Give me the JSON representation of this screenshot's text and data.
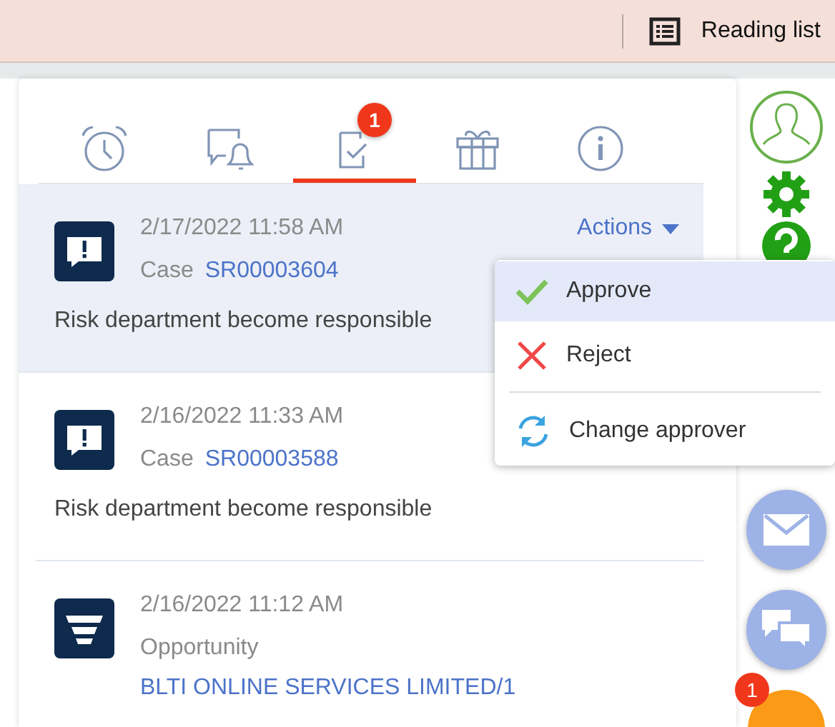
{
  "browser_toolbar": {
    "reading_list": "Reading list"
  },
  "tabs": [
    {
      "kind": "reminders",
      "selected": false
    },
    {
      "kind": "notifications",
      "selected": false
    },
    {
      "kind": "approvals",
      "selected": true,
      "badge": "1"
    },
    {
      "kind": "celebrations",
      "selected": false
    },
    {
      "kind": "info",
      "selected": false
    }
  ],
  "items": [
    {
      "kind": "case",
      "highlighted": true,
      "date": "2/17/2022 11:58 AM",
      "entity": "Case",
      "link": "SR00003604",
      "text": "Risk department become responsible",
      "actions": "Actions"
    },
    {
      "kind": "case",
      "highlighted": false,
      "date": "2/16/2022 11:33 AM",
      "entity": "Case",
      "link": "SR00003588",
      "text": "Risk department become responsible"
    },
    {
      "kind": "opportunity",
      "highlighted": false,
      "date": "2/16/2022 11:12 AM",
      "entity": "Opportunity",
      "link": "BLTI ONLINE SERVICES LIMITED/1"
    }
  ],
  "actions_menu": [
    {
      "kind": "approve",
      "label": "Approve",
      "selected": true
    },
    {
      "kind": "reject",
      "label": "Reject",
      "selected": false
    },
    {
      "kind": "change",
      "label": "Change approver",
      "selected": false
    }
  ],
  "sidebar": {
    "badge": "1"
  }
}
